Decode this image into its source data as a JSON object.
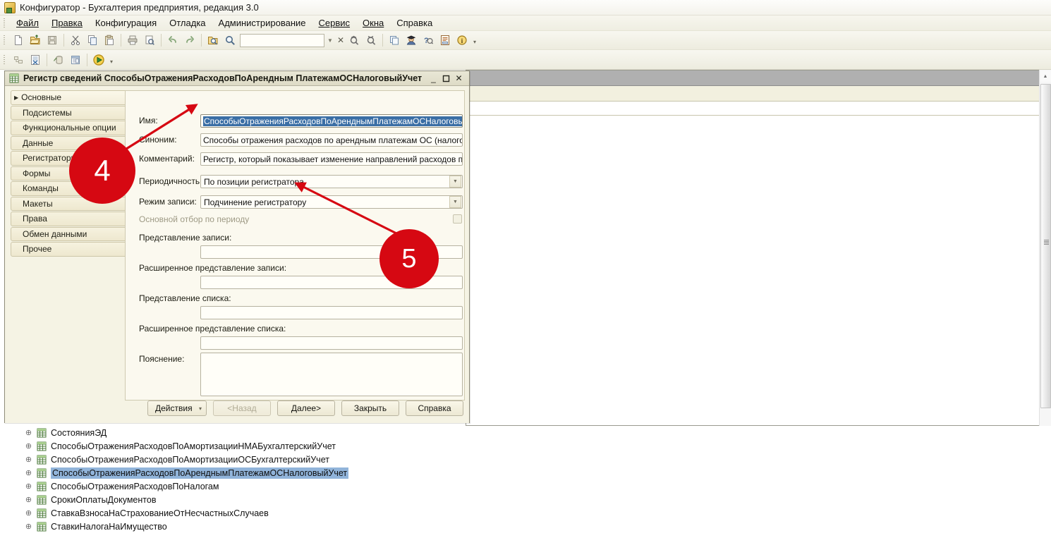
{
  "app": {
    "title": "Конфигуратор - Бухгалтерия предприятия, редакция 3.0",
    "icon": "app-logo-icon"
  },
  "menubar": {
    "items": [
      {
        "label": "Файл",
        "mnemonic": "Ф"
      },
      {
        "label": "Правка",
        "mnemonic": "П"
      },
      {
        "label": "Конфигурация",
        "mnemonic": ""
      },
      {
        "label": "Отладка",
        "mnemonic": ""
      },
      {
        "label": "Администрирование",
        "mnemonic": ""
      },
      {
        "label": "Сервис",
        "mnemonic": "С"
      },
      {
        "label": "Окна",
        "mnemonic": "О"
      },
      {
        "label": "Справка",
        "mnemonic": "а"
      }
    ]
  },
  "toolbar_row1": {
    "search_value": "",
    "icons": [
      "new-document-icon",
      "open-folder-icon",
      "save-icon",
      "cut-icon",
      "copy-icon",
      "paste-icon",
      "print-icon",
      "print-preview-icon",
      "undo-icon",
      "redo-icon",
      "find-in-files-icon",
      "search-icon"
    ],
    "after_search_icons": [
      "dropdown-arrow-icon",
      "clear-x-icon",
      "find-previous-icon",
      "find-next-icon"
    ],
    "right_icons": [
      "windows-icon",
      "syntax-assistant-icon",
      "help-context-icon",
      "template-icon",
      "about-icon"
    ],
    "overflow_caret": "▾"
  },
  "toolbar_row2": {
    "icons": [
      "configuration-tree-icon",
      "configuration-compare-icon",
      "database-config-icon",
      "form-designer-icon",
      "start-debug-icon"
    ],
    "overflow_caret": "▾"
  },
  "dialog": {
    "icon": "information-register-icon",
    "title": "Регистр сведений СпособыОтраженияРасходовПоАрендным­ПлатежамОСНалоговыйУчет",
    "title_plain": "Регистр сведений СпособыОтраженияРасходовПоАрендным ПлатежамОСНалоговыйУчет",
    "window_buttons": {
      "minimize": "_",
      "maximize": "❐",
      "close": "✕"
    },
    "nav": {
      "items": [
        {
          "label": "Основные",
          "expander": "▶",
          "active": true
        },
        {
          "label": "Подсистемы",
          "active": false
        },
        {
          "label": "Функциональные опции",
          "active": false
        },
        {
          "label": "Данные",
          "active": false
        },
        {
          "label": "Регистраторы",
          "active": false
        },
        {
          "label": "Формы",
          "active": false
        },
        {
          "label": "Команды",
          "active": false
        },
        {
          "label": "Макеты",
          "active": false
        },
        {
          "label": "Права",
          "active": false
        },
        {
          "label": "Обмен данными",
          "active": false
        },
        {
          "label": "Прочее",
          "active": false
        }
      ]
    },
    "fields": {
      "name_label": "Имя:",
      "name_value": "СпособыОтраженияРасходовПоАрендным­ПлатежамОСНалоговыйУчет",
      "synonym_label": "Синоним:",
      "synonym_value": "Способы отражения расходов по арендным платежам ОС (налоговый уч",
      "comment_label": "Комментарий:",
      "comment_value": "Регистр, который показывает изменение направлений расходов по аре",
      "periodicity_label": "Периодичность:",
      "periodicity_value": "По позиции регистратора",
      "write_mode_label": "Режим записи:",
      "write_mode_value": "Подчинение регистратору",
      "main_filter_label": "Основной отбор по периоду",
      "main_filter_checked": false,
      "record_presentation_label": "Представление записи:",
      "record_presentation_value": "",
      "extended_record_presentation_label": "Расширенное представление записи:",
      "extended_record_presentation_value": "",
      "list_presentation_label": "Представление списка:",
      "list_presentation_value": "",
      "extended_list_presentation_label": "Расширенное представление списка:",
      "extended_list_presentation_value": "",
      "explanation_label": "Пояснение:",
      "explanation_value": ""
    },
    "footer": {
      "actions_label": "Действия",
      "actions_caret": "▾",
      "back_label": "<Назад",
      "next_label": "Далее>",
      "close_label": "Закрыть",
      "help_label": "Справка"
    }
  },
  "tree": {
    "rows": [
      {
        "label": "СостоянияЭД",
        "selected": false
      },
      {
        "label": "СпособыОтраженияРасходовПоАмортизацииНМАБухгалтерскийУчет",
        "selected": false
      },
      {
        "label": "СпособыОтраженияРасходовПоАмортизацииОСБухгалтерскийУчет",
        "selected": false
      },
      {
        "label": "СпособыОтраженияРасходовПоАрендным­ПлатежамОСНалоговыйУчет",
        "selected": true
      },
      {
        "label": "СпособыОтраженияРасходовПоНалогам",
        "selected": false
      },
      {
        "label": "СрокиОплатыДокументов",
        "selected": false
      },
      {
        "label": "СтавкаВзносаНаСтрахованиеОтНесчастныхСлучаев",
        "selected": false
      },
      {
        "label": "СтавкиНалогаНаИмущество",
        "selected": false
      }
    ],
    "expander_glyph": "⊕",
    "row_icon": "information-register-icon"
  },
  "annotations": {
    "accent_color": "#d60812",
    "badges": [
      {
        "number": "4",
        "points_to": "name-input"
      },
      {
        "number": "5",
        "points_to": "write-mode-combo"
      }
    ]
  }
}
